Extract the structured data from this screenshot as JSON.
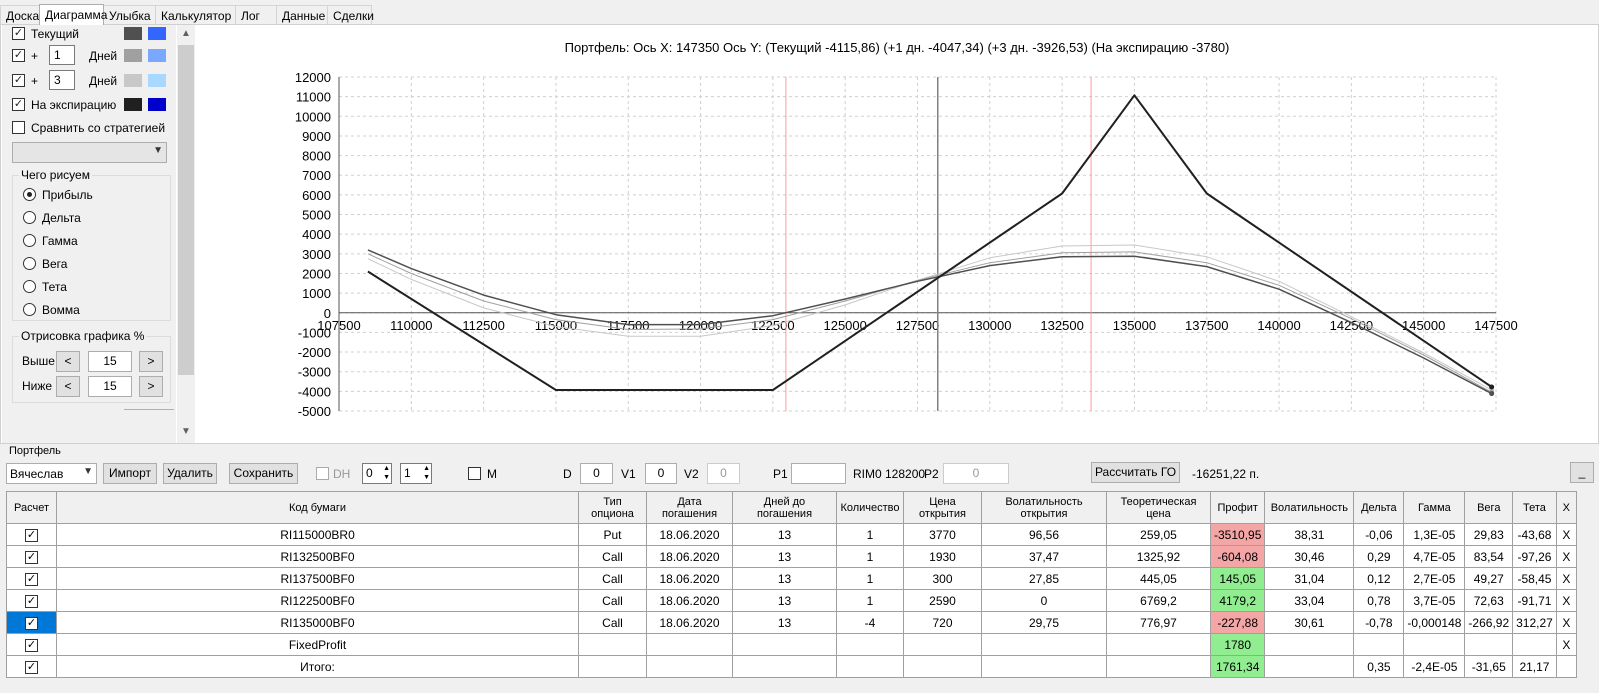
{
  "tabs": [
    "Доска",
    "Диаграмма",
    "Улыбка",
    "Калькулятор",
    "Лог",
    "Данные",
    "Сделки"
  ],
  "active_tab": 1,
  "left_panel": {
    "current_label": "Текущий",
    "plus": "+",
    "days1": "1",
    "days2": "3",
    "days_label": "Дней",
    "expiry_label": "На экспирацию",
    "compare_label": "Сравнить со стратегией",
    "what_group": "Чего рисуем",
    "radios": [
      "Прибыль",
      "Дельта",
      "Гамма",
      "Вега",
      "Тета",
      "Вомма"
    ],
    "draw_group": "Отрисовка графика %",
    "above_label": "Выше",
    "below_label": "Ниже",
    "above_value": "15",
    "below_value": "15",
    "btn_left": "<",
    "btn_right": ">",
    "swatch_colors": {
      "current": [
        "#505050",
        "#3366ff"
      ],
      "plus1": [
        "#a0a0a0",
        "#7aa8ff"
      ],
      "plus3": [
        "#c8c8c8",
        "#a8d8ff"
      ],
      "expiry": [
        "#202020",
        "#0000cc"
      ]
    }
  },
  "chart": {
    "title": "Портфель: Ось X: 147350 Ось Y:  (Текущий -4115,86)  (+1 дн. -4047,34)  (+3 дн. -3926,53)  (На экспирацию -3780)"
  },
  "chart_data": {
    "type": "line",
    "xlim": [
      107500,
      147500
    ],
    "ylim": [
      -5000,
      12000
    ],
    "x_ticks": [
      107500,
      110000,
      112500,
      115000,
      117500,
      120000,
      122500,
      125000,
      127500,
      130000,
      132500,
      135000,
      137500,
      140000,
      142500,
      145000,
      147500
    ],
    "y_ticks": [
      12000,
      11000,
      10000,
      9000,
      8000,
      7000,
      6000,
      5000,
      4000,
      3000,
      2000,
      1000,
      0,
      -1000,
      -2000,
      -3000,
      -4000,
      -5000
    ],
    "vlines": [
      {
        "x": 122950,
        "color": "#ff9999"
      },
      {
        "x": 128200,
        "color": "#808080"
      },
      {
        "x": 133500,
        "color": "#ff9999"
      }
    ],
    "series": [
      {
        "color": "#202020",
        "width": 2,
        "points": [
          [
            108500,
            2100
          ],
          [
            115000,
            -3930
          ],
          [
            122500,
            -3930
          ],
          [
            132500,
            6070
          ],
          [
            135000,
            11070
          ],
          [
            137500,
            6070
          ],
          [
            147350,
            -3780
          ]
        ]
      },
      {
        "color": "#505050",
        "width": 1.5,
        "points": [
          [
            108500,
            3200
          ],
          [
            110000,
            2250
          ],
          [
            112500,
            900
          ],
          [
            115000,
            -100
          ],
          [
            117500,
            -600
          ],
          [
            120000,
            -600
          ],
          [
            122500,
            -150
          ],
          [
            125000,
            700
          ],
          [
            127500,
            1600
          ],
          [
            130000,
            2400
          ],
          [
            132500,
            2850
          ],
          [
            135000,
            2880
          ],
          [
            137500,
            2350
          ],
          [
            140000,
            1200
          ],
          [
            142500,
            -500
          ],
          [
            145000,
            -2300
          ],
          [
            147350,
            -4116
          ]
        ]
      },
      {
        "color": "#a0a0a0",
        "width": 1,
        "points": [
          [
            108500,
            3000
          ],
          [
            110000,
            2000
          ],
          [
            112500,
            600
          ],
          [
            115000,
            -350
          ],
          [
            117500,
            -850
          ],
          [
            120000,
            -820
          ],
          [
            122500,
            -350
          ],
          [
            125000,
            600
          ],
          [
            127500,
            1650
          ],
          [
            130000,
            2550
          ],
          [
            132500,
            3050
          ],
          [
            135000,
            3100
          ],
          [
            137500,
            2550
          ],
          [
            140000,
            1400
          ],
          [
            142500,
            -300
          ],
          [
            145000,
            -2150
          ],
          [
            147350,
            -4047
          ]
        ]
      },
      {
        "color": "#c8c8c8",
        "width": 1,
        "points": [
          [
            108500,
            2750
          ],
          [
            110000,
            1700
          ],
          [
            112500,
            250
          ],
          [
            115000,
            -700
          ],
          [
            117500,
            -1200
          ],
          [
            120000,
            -1200
          ],
          [
            122500,
            -650
          ],
          [
            125000,
            400
          ],
          [
            127500,
            1650
          ],
          [
            130000,
            2800
          ],
          [
            132500,
            3400
          ],
          [
            135000,
            3450
          ],
          [
            137500,
            2850
          ],
          [
            140000,
            1600
          ],
          [
            142500,
            -200
          ],
          [
            145000,
            -2050
          ],
          [
            147350,
            -3927
          ]
        ]
      }
    ]
  },
  "portfolio": {
    "group": "Портфель",
    "name": "Вячеслав",
    "import": "Импорт",
    "delete": "Удалить",
    "save": "Сохранить",
    "dh": "DH",
    "dh1": "0",
    "dh2": "1",
    "m": "M",
    "d": "D",
    "d_val": "0",
    "v1": "V1",
    "v1_val": "0",
    "v2": "V2",
    "v2_val": "0",
    "p1": "P1",
    "rim": "RIM0 128200",
    "p2": "P2",
    "p2_val": "0",
    "calc_go": "Рассчитать ГО",
    "go_value": "-16251,22 п.",
    "minimize": "_"
  },
  "table": {
    "headers": [
      "Расчет",
      "Код бумаги",
      "Тип опциона",
      "Дата погашения",
      "Дней до погашения",
      "Количество",
      "Цена открытия",
      "Волатильность открытия",
      "Теоретическая цена",
      "Профит",
      "Волатильность",
      "Дельта",
      "Гамма",
      "Вега",
      "Тета",
      "X"
    ],
    "rows": [
      [
        "RI115000BR0",
        "Put",
        "18.06.2020",
        "13",
        "1",
        "3770",
        "96,56",
        "259,05",
        "-3510,95",
        "38,31",
        "-0,06",
        "1,3E-05",
        "29,83",
        "-43,68"
      ],
      [
        "RI132500BF0",
        "Call",
        "18.06.2020",
        "13",
        "1",
        "1930",
        "37,47",
        "1325,92",
        "-604,08",
        "30,46",
        "0,29",
        "4,7E-05",
        "83,54",
        "-97,26"
      ],
      [
        "RI137500BF0",
        "Call",
        "18.06.2020",
        "13",
        "1",
        "300",
        "27,85",
        "445,05",
        "145,05",
        "31,04",
        "0,12",
        "2,7E-05",
        "49,27",
        "-58,45"
      ],
      [
        "RI122500BF0",
        "Call",
        "18.06.2020",
        "13",
        "1",
        "2590",
        "0",
        "6769,2",
        "4179,2",
        "33,04",
        "0,78",
        "3,7E-05",
        "72,63",
        "-91,71"
      ],
      [
        "RI135000BF0",
        "Call",
        "18.06.2020",
        "13",
        "-4",
        "720",
        "29,75",
        "776,97",
        "-227,88",
        "30,61",
        "-0,78",
        "-0,000148",
        "-266,92",
        "312,27"
      ],
      [
        "FixedProfit",
        "",
        "",
        "",
        "",
        "",
        "",
        "",
        "1780",
        "",
        "",
        "",
        "",
        ""
      ],
      [
        "Итого:",
        "",
        "",
        "",
        "",
        "",
        "",
        "",
        "1761,34",
        "",
        "0,35",
        "-2,4E-05",
        "-31,65",
        "21,17"
      ]
    ],
    "x_label": "X",
    "check": "✓"
  }
}
